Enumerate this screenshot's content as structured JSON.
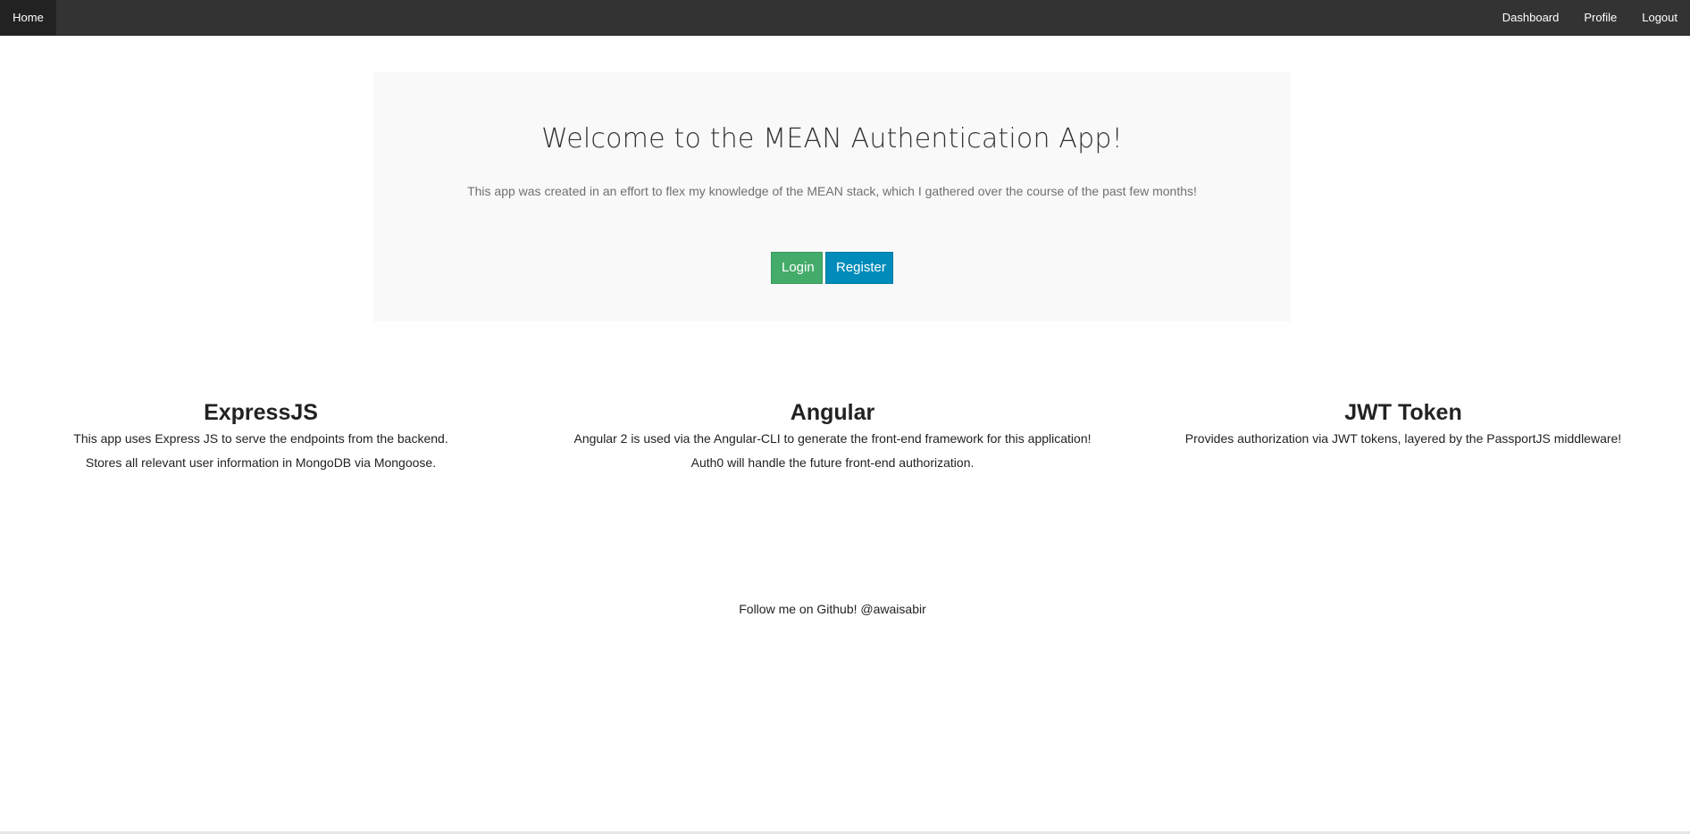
{
  "navbar": {
    "home_label": "Home",
    "dashboard_label": "Dashboard",
    "profile_label": "Profile",
    "logout_label": "Logout"
  },
  "jumbotron": {
    "title": "Welcome to the MEAN Authentication App!",
    "lead": "This app was created in an effort to flex my knowledge of the MEAN stack, which I gathered over the course of the past few months!",
    "login_label": "Login",
    "register_label": "Register"
  },
  "features": [
    {
      "title": "ExpressJS",
      "lines": [
        "This app uses Express JS to serve the endpoints from the backend.",
        "Stores all relevant user information in MongoDB via Mongoose."
      ]
    },
    {
      "title": "Angular",
      "lines": [
        "Angular 2 is used via the Angular-CLI to generate the front-end framework for this application!",
        "Auth0 will handle the future front-end authorization."
      ]
    },
    {
      "title": "JWT Token",
      "lines": [
        "Provides authorization via JWT tokens, layered by the PassportJS middleware!"
      ]
    }
  ],
  "footer": {
    "text": "Follow me on Github! @awaisabir"
  },
  "colors": {
    "navbar_bg": "#333333",
    "login_button": "#43ac6a",
    "register_button": "#008cba",
    "jumbotron_bg": "#f9f9f9"
  }
}
